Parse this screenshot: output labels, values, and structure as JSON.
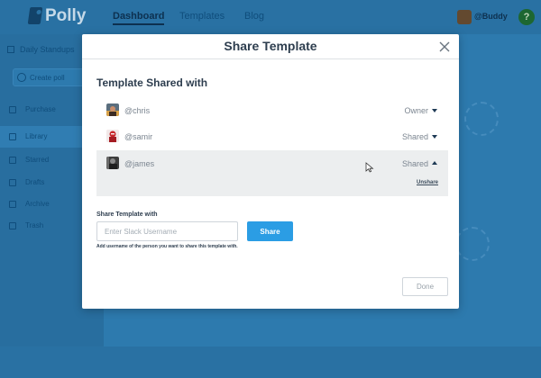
{
  "app": {
    "brand": "Polly",
    "nav": [
      "Dashboard",
      "Templates",
      "Blog"
    ],
    "user": "@Buddy",
    "help_glyph": "?"
  },
  "sidebar": {
    "header": "Daily Standups",
    "create_label": "Create poll",
    "items": [
      {
        "label": "Purchase",
        "icon": "cart-icon"
      },
      {
        "label": "Library",
        "icon": "library-icon"
      },
      {
        "label": "Starred",
        "icon": "star-icon"
      },
      {
        "label": "Drafts",
        "icon": "draft-icon"
      },
      {
        "label": "Archive",
        "icon": "archive-icon"
      },
      {
        "label": "Trash",
        "icon": "trash-icon"
      }
    ]
  },
  "modal": {
    "title": "Share Template",
    "section_title": "Template Shared with",
    "rows": [
      {
        "username": "@chris",
        "role": "Owner",
        "expanded": false
      },
      {
        "username": "@samir",
        "role": "Shared",
        "expanded": false
      },
      {
        "username": "@james",
        "role": "Shared",
        "expanded": true,
        "action": "Unshare"
      }
    ],
    "input_label": "Share Template with",
    "input_placeholder": "Enter Slack Username",
    "input_value": "",
    "share_label": "Share",
    "helper_text": "Add username of the person you want to share this template with.",
    "done_label": "Done"
  },
  "colors": {
    "accent": "#2b9de4",
    "overlay": "#2f7fb3",
    "title_text": "#2e3e4f"
  }
}
